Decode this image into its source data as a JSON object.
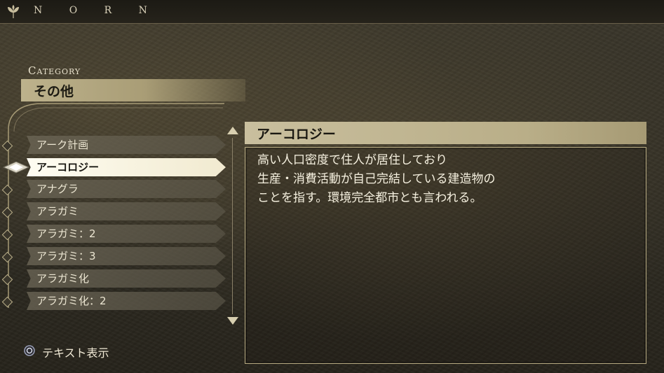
{
  "topbar": {
    "brand": "N O R N",
    "logo_icon": "leaf-emblem-icon"
  },
  "category": {
    "label": "Category",
    "value": "その他"
  },
  "list": {
    "items": [
      {
        "label": "アーク計画",
        "selected": false
      },
      {
        "label": "アーコロジー",
        "selected": true
      },
      {
        "label": "アナグラ",
        "selected": false
      },
      {
        "label": "アラガミ",
        "selected": false
      },
      {
        "label": "アラガミ：2",
        "selected": false
      },
      {
        "label": "アラガミ：3",
        "selected": false
      },
      {
        "label": "アラガミ化",
        "selected": false
      },
      {
        "label": "アラガミ化：2",
        "selected": false
      }
    ],
    "scroll_up_icon": "triangle-up-icon",
    "scroll_down_icon": "triangle-down-icon",
    "selection_icon": "diamond-cursor-icon"
  },
  "content": {
    "title": "アーコロジー",
    "body": "高い人口密度で住人が居住しており\n生産・消費活動が自己完結している建造物の\nことを指す。環境完全都市とも言われる。"
  },
  "footer": {
    "button_icon": "circle-button-icon",
    "hint": "テキスト表示"
  },
  "colors": {
    "accent": "#bdb28c",
    "selected_bg": "#f7f2de",
    "background": "#35312a"
  }
}
